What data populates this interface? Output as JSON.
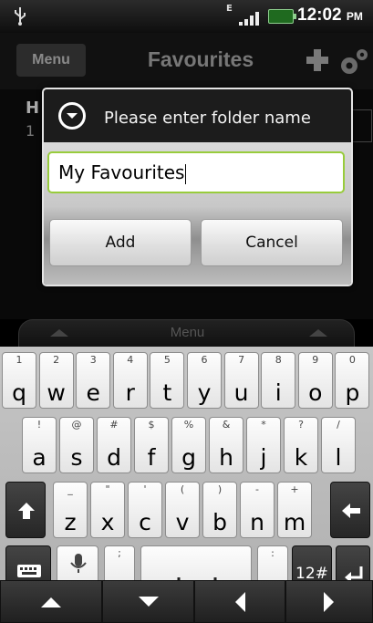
{
  "status_bar": {
    "network_type": "E",
    "time": "12:02",
    "ampm": "PM"
  },
  "header": {
    "menu_label": "Menu",
    "title": "Favourites"
  },
  "background_list": {
    "first_item_title": "H",
    "first_item_sub": "1"
  },
  "dialog": {
    "title": "Please enter folder name",
    "input_value": "My Favourites",
    "add_label": "Add",
    "cancel_label": "Cancel"
  },
  "keyboard": {
    "menu_label": "Menu",
    "row1": [
      {
        "main": "q",
        "sub": "1"
      },
      {
        "main": "w",
        "sub": "2"
      },
      {
        "main": "e",
        "sub": "3"
      },
      {
        "main": "r",
        "sub": "4"
      },
      {
        "main": "t",
        "sub": "5"
      },
      {
        "main": "y",
        "sub": "6"
      },
      {
        "main": "u",
        "sub": "7"
      },
      {
        "main": "i",
        "sub": "8"
      },
      {
        "main": "o",
        "sub": "9"
      },
      {
        "main": "p",
        "sub": "0"
      }
    ],
    "row2": [
      {
        "main": "a",
        "sub": "!"
      },
      {
        "main": "s",
        "sub": "@"
      },
      {
        "main": "d",
        "sub": "#"
      },
      {
        "main": "f",
        "sub": "$"
      },
      {
        "main": "g",
        "sub": "%"
      },
      {
        "main": "h",
        "sub": "&"
      },
      {
        "main": "j",
        "sub": "*"
      },
      {
        "main": "k",
        "sub": "?"
      },
      {
        "main": "l",
        "sub": "/"
      }
    ],
    "row3": [
      {
        "main": "z",
        "sub": "_"
      },
      {
        "main": "x",
        "sub": "\""
      },
      {
        "main": "c",
        "sub": "'"
      },
      {
        "main": "v",
        "sub": "("
      },
      {
        "main": "b",
        "sub": ")"
      },
      {
        "main": "n",
        "sub": "-"
      },
      {
        "main": "m",
        "sub": "+"
      }
    ],
    "lang_label": "EN",
    "comma_main": ",",
    "comma_sub": ";",
    "period_main": ".",
    "period_sub": ":",
    "symbols_label": "12#"
  },
  "colors": {
    "input_focus": "#98cc3c",
    "battery": "#1f6a1f"
  },
  "icons": [
    "usb-icon",
    "signal-icon",
    "battery-icon",
    "add-icon",
    "settings-icon",
    "dialog-dropdown-icon",
    "shift-icon",
    "backspace-icon",
    "keyboard-icon",
    "mic-icon",
    "space-icon",
    "enter-icon",
    "nav-up-icon",
    "nav-down-icon",
    "nav-left-icon",
    "nav-right-icon"
  ]
}
